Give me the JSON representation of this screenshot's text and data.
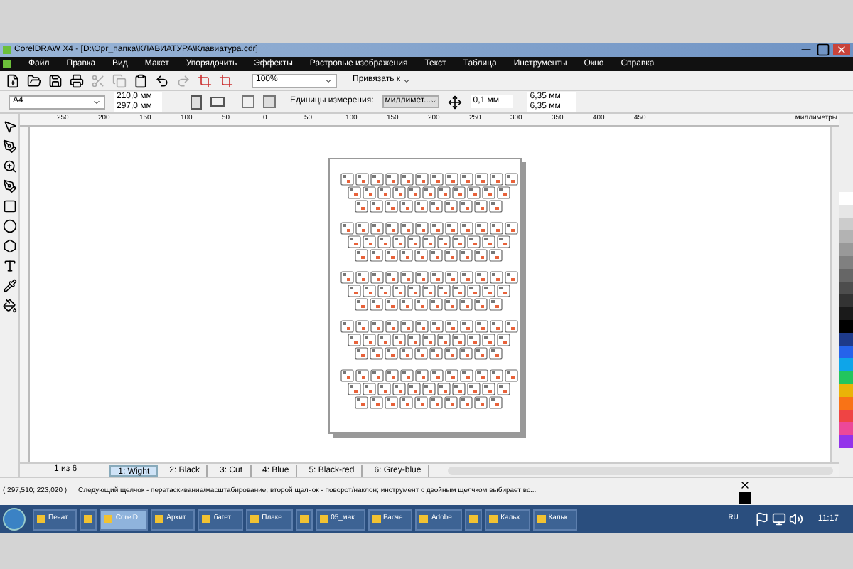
{
  "window": {
    "title": "CorelDRAW X4 - [D:\\Oрг_папка\\КЛАВИАТУРА\\Клавиатура.cdr]"
  },
  "menu": [
    "Файл",
    "Правка",
    "Вид",
    "Макет",
    "Упорядочить",
    "Эффекты",
    "Растровые изображения",
    "Текст",
    "Таблица",
    "Инструменты",
    "Окно",
    "Справка"
  ],
  "toolbar": {
    "zoom": "100%",
    "snap": "Привязать к"
  },
  "property_bar": {
    "page_size": "A4",
    "width": "210,0 мм",
    "height": "297,0 мм",
    "units_label": "Единицы измерения:",
    "units": "миллимет...",
    "nudge": "0,1 мм",
    "dup_x": "6,35 мм",
    "dup_y": "6,35 мм"
  },
  "ruler": {
    "unit": "миллиметры",
    "labels": [
      "250",
      "200",
      "150",
      "100",
      "50",
      "0",
      "50",
      "100",
      "150",
      "200",
      "250",
      "300",
      "350",
      "400",
      "450"
    ]
  },
  "page_nav": {
    "position": "1 из 6"
  },
  "page_tabs": [
    {
      "label": "1: Wight",
      "selected": true
    },
    {
      "label": "2: Black",
      "selected": false
    },
    {
      "label": "3: Cut",
      "selected": false
    },
    {
      "label": "4: Blue",
      "selected": false
    },
    {
      "label": "5: Black-red",
      "selected": false
    },
    {
      "label": "6: Grey-blue",
      "selected": false
    }
  ],
  "palette": [
    {
      "color": "#ffffff"
    },
    {
      "color": "#e6e6e6"
    },
    {
      "color": "#cccccc"
    },
    {
      "color": "#b3b3b3"
    },
    {
      "color": "#999999"
    },
    {
      "color": "#808080"
    },
    {
      "color": "#666666"
    },
    {
      "color": "#4d4d4d"
    },
    {
      "color": "#333333"
    },
    {
      "color": "#1a1a1a"
    },
    {
      "color": "#000000"
    },
    {
      "color": "#1e3a8a"
    },
    {
      "color": "#2563eb"
    },
    {
      "color": "#0ea5e9"
    },
    {
      "color": "#22c55e"
    },
    {
      "color": "#eab308"
    },
    {
      "color": "#f97316"
    },
    {
      "color": "#ef4444"
    },
    {
      "color": "#ec4899"
    },
    {
      "color": "#9333ea"
    }
  ],
  "status_bar": {
    "coords": "( 297,510; 223,020 )",
    "hint": "Следующий щелчок - перетаскивание/масштабирование; второй щелчок - поворот/наклон; инструмент с двойным щелчком выбирает вс..."
  },
  "taskbar": {
    "items": [
      {
        "label": "Печат...",
        "selected": false
      },
      {
        "selected": false
      },
      {
        "label": "CorelD...",
        "selected": true
      },
      {
        "label": "Архит...",
        "selected": false
      },
      {
        "label": "багет ...",
        "selected": false
      },
      {
        "label": "Плаке...",
        "selected": false
      },
      {
        "selected": false
      },
      {
        "label": "05_мак...",
        "selected": false
      },
      {
        "label": "Расче...",
        "selected": false
      },
      {
        "label": "Adobe...",
        "selected": false
      },
      {
        "selected": false
      },
      {
        "label": "Кальк...",
        "selected": false
      },
      {
        "label": "Кальк...",
        "selected": false
      }
    ],
    "language": "RU",
    "clock": "11:17"
  }
}
